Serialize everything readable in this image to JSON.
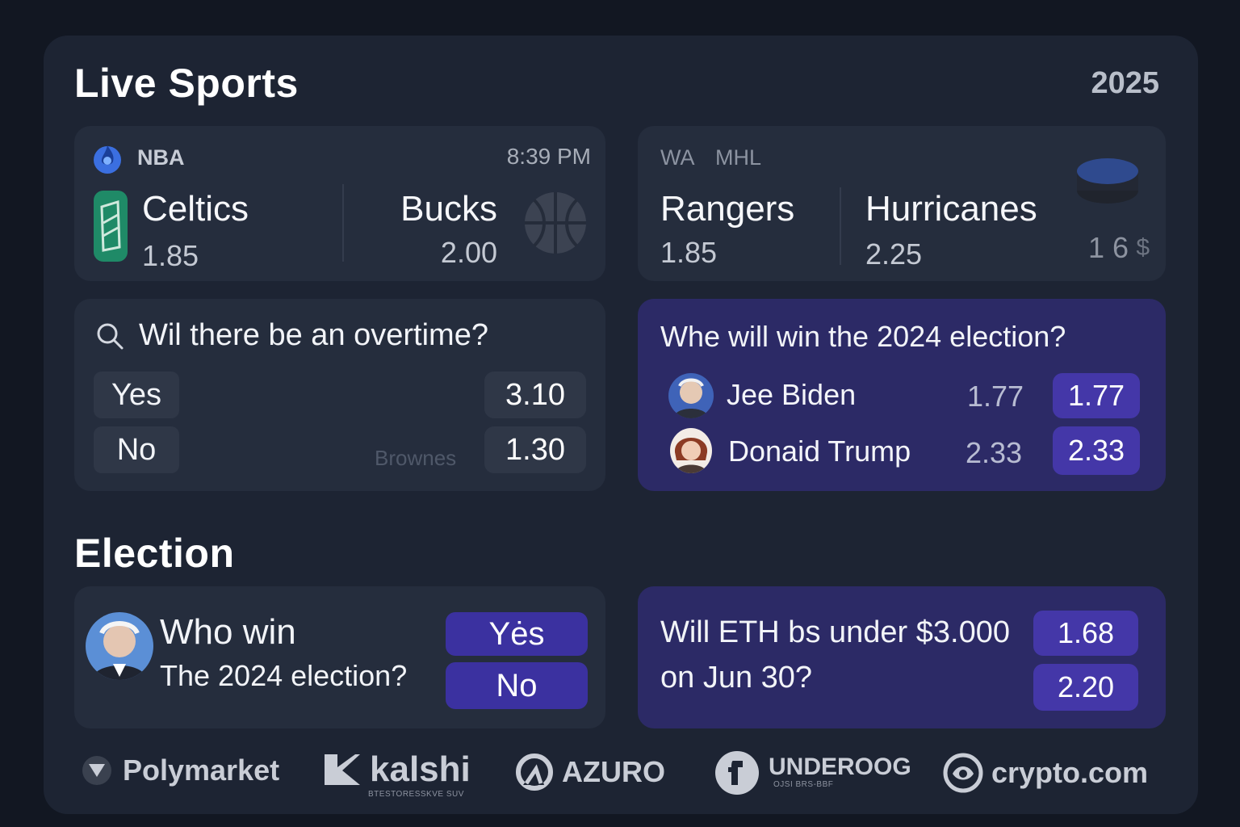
{
  "header": {
    "title": "Live Sports",
    "year": "2025"
  },
  "nba_card": {
    "league": "NBA",
    "time": "8:39 PM",
    "team1": {
      "name": "Celtics",
      "odds": "1.85"
    },
    "team2": {
      "name": "Bucks",
      "odds": "2.00"
    }
  },
  "nhl_card": {
    "league_left": "WA",
    "league_right": "MHL",
    "team1": {
      "name": "Rangers",
      "odds": "1.85"
    },
    "team2": {
      "name": "Hurricanes",
      "odds": "2.25"
    },
    "extra": "1 6"
  },
  "overtime_card": {
    "question": "Wil there be an overtime?",
    "options": [
      {
        "label": "Yes",
        "odds": "3.10"
      },
      {
        "label": "No",
        "odds": "1.30"
      }
    ],
    "faint_label": "Brownes"
  },
  "election_market": {
    "question": "Whe will win the 2024 election?",
    "candidates": [
      {
        "name": "Jee Biden",
        "odds": "1.77",
        "button_odds": "1.77"
      },
      {
        "name": "Donaid Trump",
        "odds": "2.33",
        "button_odds": "2.33"
      }
    ]
  },
  "election_section": {
    "title": "Election"
  },
  "who_win_card": {
    "line1": "Who win",
    "line2": "The 2024 election?",
    "yes_label": "Yės",
    "no_label": "No"
  },
  "eth_card": {
    "line1": "Will ETH bs under $3.000",
    "line2": "on Jun 30?",
    "odds": [
      "1.68",
      "2.20"
    ]
  },
  "partners": [
    {
      "name": "Polymarket",
      "icon": "polymarket-icon"
    },
    {
      "name": "kalshi",
      "sub": "BTESTORESSKVE SUV",
      "icon": "kalshi-icon"
    },
    {
      "name": "AZURO",
      "icon": "azuro-icon"
    },
    {
      "name": "UNDEROOG",
      "sub": "OJSI BRS-BBF",
      "icon": "underdog-icon"
    },
    {
      "name": "crypto.com",
      "icon": "crypto-com-icon"
    }
  ],
  "colors": {
    "background": "#121722",
    "panel": "#1d2433",
    "card": "#252d3d",
    "accent": "#4437a8",
    "purple_card": "#2c2a66"
  }
}
